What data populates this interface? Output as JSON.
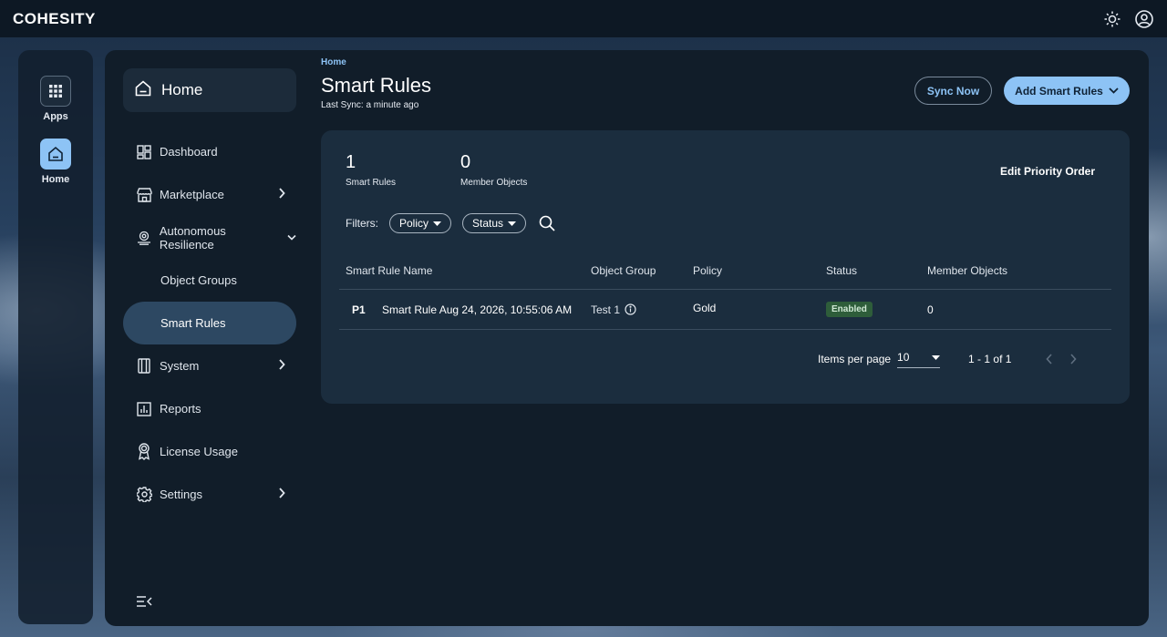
{
  "brand": {
    "logo": "COHESITY"
  },
  "rail": {
    "items": [
      {
        "label": "Apps",
        "icon": "apps-grid-icon"
      },
      {
        "label": "Home",
        "icon": "home-icon"
      }
    ]
  },
  "sidenav": {
    "home_label": "Home",
    "items": [
      {
        "label": "Dashboard",
        "icon": "dashboard-icon"
      },
      {
        "label": "Marketplace",
        "icon": "store-icon"
      },
      {
        "label": "Autonomous Resilience",
        "icon": "resilience-icon"
      },
      {
        "label": "Object Groups"
      },
      {
        "label": "Smart Rules"
      },
      {
        "label": "System",
        "icon": "system-icon"
      },
      {
        "label": "Reports",
        "icon": "reports-icon"
      },
      {
        "label": "License Usage",
        "icon": "license-icon"
      },
      {
        "label": "Settings",
        "icon": "gear-icon"
      }
    ]
  },
  "header": {
    "breadcrumb": "Home",
    "title": "Smart Rules",
    "last_sync": "Last Sync: a minute ago",
    "sync_label": "Sync Now",
    "add_label": "Add Smart Rules"
  },
  "stats": {
    "rules_count": "1",
    "rules_label": "Smart Rules",
    "members_count": "0",
    "members_label": "Member Objects",
    "edit_priority": "Edit Priority Order"
  },
  "filters": {
    "label": "Filters:",
    "policy": "Policy",
    "status": "Status"
  },
  "table": {
    "columns": [
      "Smart Rule Name",
      "Object Group",
      "Policy",
      "Status",
      "Member Objects"
    ],
    "rows": [
      {
        "priority": "P1",
        "name": "Smart Rule Aug 24, 2026, 10:55:06 AM",
        "object_group": "Test 1",
        "policy": "Gold",
        "status": "Enabled",
        "member_objects": "0"
      }
    ]
  },
  "pagination": {
    "items_per_page_label": "Items per page",
    "items_per_page": "10",
    "range": "1 - 1 of 1"
  },
  "colors": {
    "accent": "#8dc3f5",
    "enabled_badge": "#2e5d3a"
  }
}
